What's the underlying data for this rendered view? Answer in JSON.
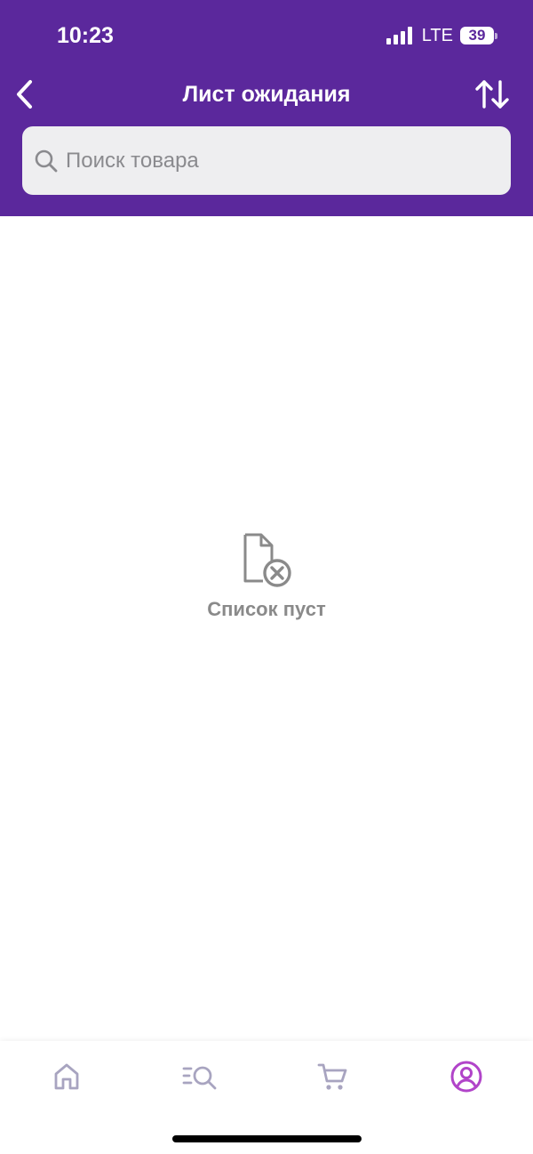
{
  "status_bar": {
    "time": "10:23",
    "network": "LTE",
    "battery": "39"
  },
  "header": {
    "title": "Лист ожидания"
  },
  "search": {
    "placeholder": "Поиск товара"
  },
  "empty_state": {
    "message": "Список пуст"
  },
  "tab_bar": {
    "items": [
      {
        "icon": "home-icon",
        "active": false
      },
      {
        "icon": "catalog-search-icon",
        "active": false
      },
      {
        "icon": "cart-icon",
        "active": false
      },
      {
        "icon": "profile-icon",
        "active": true
      }
    ]
  },
  "colors": {
    "brand": "#5b289c",
    "tab_active": "#b144c9",
    "tab_inactive": "#a8a4c0",
    "empty_gray": "#8a8a8a"
  }
}
